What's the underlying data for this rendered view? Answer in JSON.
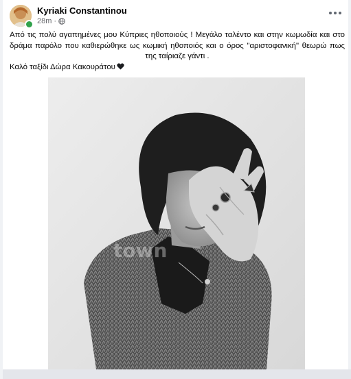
{
  "post": {
    "author": "Kyriaki Constantinou",
    "time": "28m",
    "privacy_icon": "globe-icon",
    "more_icon": "more-options-icon",
    "text_line1": "Από τις πολύ αγαπημένες μου Κύπριες ηθοποιούς ! Μεγάλο ταλέντο και στην κωμωδία και στο δράμα παρόλο που καθιερώθηκε ως κωμική ηθοποιός και ο όρος \"αριστοφανική\"  θεωρώ πως της ταίριαζε γάντι .",
    "text_line2": "Καλό ταξίδι Δώρα Κακουράτου",
    "heart_icon": "black-heart-icon"
  },
  "photo": {
    "watermark": "town"
  }
}
